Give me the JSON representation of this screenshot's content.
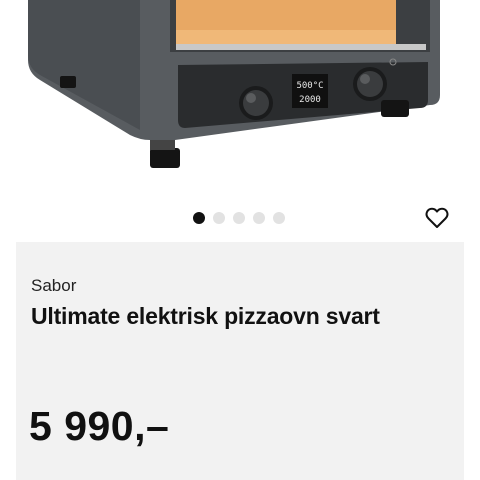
{
  "product_image": {
    "icon": "pizza-oven-photo",
    "display": {
      "line1": "500°C",
      "line2": "2000"
    }
  },
  "carousel": {
    "active_index": 0,
    "total": 5
  },
  "favorite": {
    "icon": "heart-outline-icon"
  },
  "product": {
    "brand": "Sabor",
    "title": "Ultimate elektrisk pizzaovn svart",
    "price": "5 990,–"
  },
  "colors": {
    "card_background": "#f2f2f2",
    "active_dot": "#111111",
    "inactive_dot": "#e2e2e2"
  }
}
